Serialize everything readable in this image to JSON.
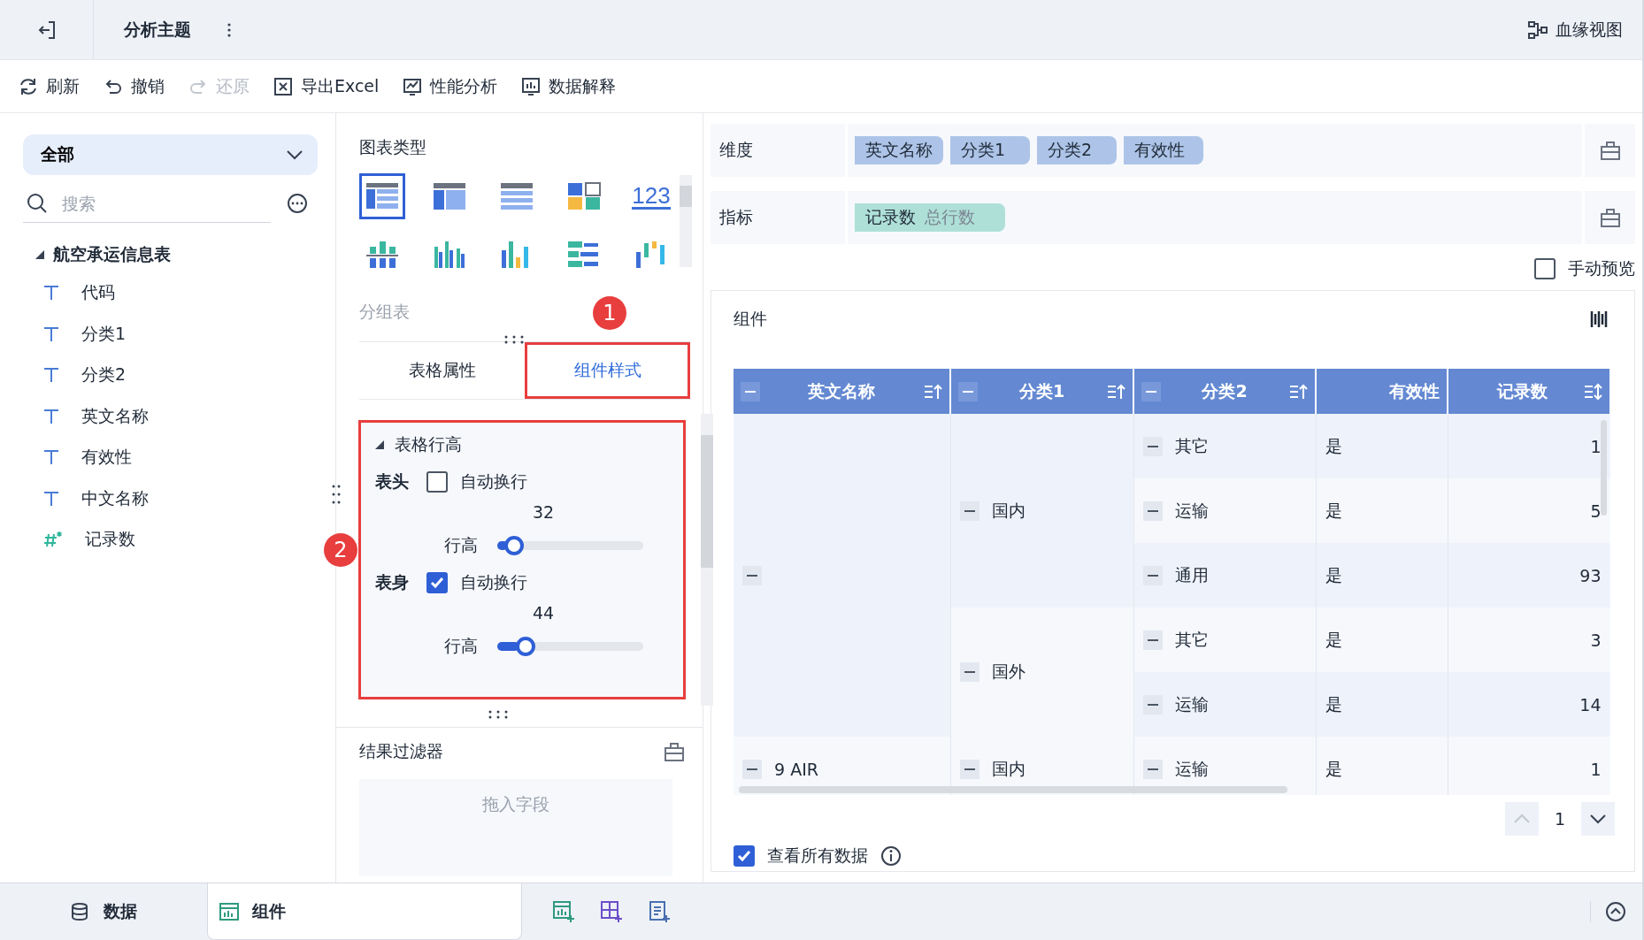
{
  "header": {
    "title": "分析主题",
    "lineage": "血缘视图"
  },
  "toolbar": [
    {
      "label": "刷新",
      "kind": "refresh",
      "disabled": false
    },
    {
      "label": "撤销",
      "kind": "undo",
      "disabled": false
    },
    {
      "label": "还原",
      "kind": "redo",
      "disabled": true
    },
    {
      "label": "导出Excel",
      "kind": "export",
      "disabled": false
    },
    {
      "label": "性能分析",
      "kind": "performance",
      "disabled": false
    },
    {
      "label": "数据解释",
      "kind": "explain",
      "disabled": false
    }
  ],
  "data_panel": {
    "scope": "全部",
    "search": {
      "placeholder": "搜索"
    },
    "tree": {
      "label": "航空承运信息表",
      "expanded": true,
      "children": [
        {
          "label": "代码",
          "kind": "text"
        },
        {
          "label": "分类1",
          "kind": "text"
        },
        {
          "label": "分类2",
          "kind": "text"
        },
        {
          "label": "英文名称",
          "kind": "text"
        },
        {
          "label": "有效性",
          "kind": "text"
        },
        {
          "label": "中文名称",
          "kind": "text"
        },
        {
          "label": "记录数",
          "kind": "number"
        }
      ]
    }
  },
  "chart_types": {
    "title": "图表类型",
    "current": "分组表",
    "items": [
      {
        "kind": "grouped-table",
        "selected": true
      },
      {
        "kind": "cross-table",
        "selected": false
      },
      {
        "kind": "detail-table",
        "selected": false
      },
      {
        "kind": "blocks",
        "selected": false
      },
      {
        "kind": "number",
        "text": "123",
        "selected": false
      },
      {
        "kind": "stacked-bar",
        "selected": false
      },
      {
        "kind": "grouped-bar",
        "selected": false
      },
      {
        "kind": "bar",
        "selected": false
      },
      {
        "kind": "horizontal-bar",
        "selected": false
      },
      {
        "kind": "waterfall",
        "selected": false
      }
    ]
  },
  "settings": {
    "callout": "1",
    "tabs": [
      {
        "label": "表格属性",
        "selected": false
      },
      {
        "label": "组件样式",
        "selected": true
      }
    ]
  },
  "row_height": {
    "callout": "2",
    "title": "表格行高",
    "expanded": true,
    "sections": [
      {
        "label": "表头",
        "wrap_label": "自动换行",
        "wrap": false,
        "value": "32",
        "slider_label": "行高",
        "level": 0.07
      },
      {
        "label": "表身",
        "wrap_label": "自动换行",
        "wrap": true,
        "value": "44",
        "slider_label": "行高",
        "level": 0.15
      }
    ]
  },
  "result_filter": {
    "title": "结果过滤器",
    "placeholder": "拖入字段"
  },
  "dimensions": {
    "label": "维度",
    "fields": [
      "英文名称",
      "分类1",
      "分类2",
      "有效性"
    ]
  },
  "measures": {
    "label": "指标",
    "fields": [
      {
        "name": "记录数",
        "aggregation": "总行数"
      }
    ]
  },
  "manual_preview": {
    "label": "手动预览",
    "checked": false
  },
  "component": {
    "title": "组件",
    "table": {
      "columns": [
        {
          "label": "英文名称",
          "kind": "group"
        },
        {
          "label": "分类1",
          "kind": "group"
        },
        {
          "label": "分类2",
          "kind": "group"
        },
        {
          "label": "有效性",
          "kind": "value"
        },
        {
          "label": "记录数",
          "kind": "measure"
        }
      ],
      "groups": [
        {
          "children": [
            {
              "label": "国内",
              "children": [
                {
                  "label": "其它",
                  "valid": "是",
                  "count": "1"
                },
                {
                  "label": "运输",
                  "valid": "是",
                  "count": "5"
                },
                {
                  "label": "通用",
                  "valid": "是",
                  "count": "93"
                }
              ]
            },
            {
              "label": "国外",
              "children": [
                {
                  "label": "其它",
                  "valid": "是",
                  "count": "3"
                },
                {
                  "label": "运输",
                  "valid": "是",
                  "count": "14"
                }
              ]
            }
          ]
        },
        {
          "label": "9 AIR",
          "children": [
            {
              "label": "国内",
              "children": [
                {
                  "label": "运输",
                  "valid": "是",
                  "count": "1"
                }
              ]
            }
          ]
        }
      ]
    },
    "page": "1",
    "view_all": {
      "label": "查看所有数据",
      "checked": true
    }
  },
  "bottom_tabs": [
    {
      "label": "数据",
      "kind": "database",
      "selected": false
    },
    {
      "label": "组件",
      "kind": "chart",
      "selected": true
    }
  ]
}
